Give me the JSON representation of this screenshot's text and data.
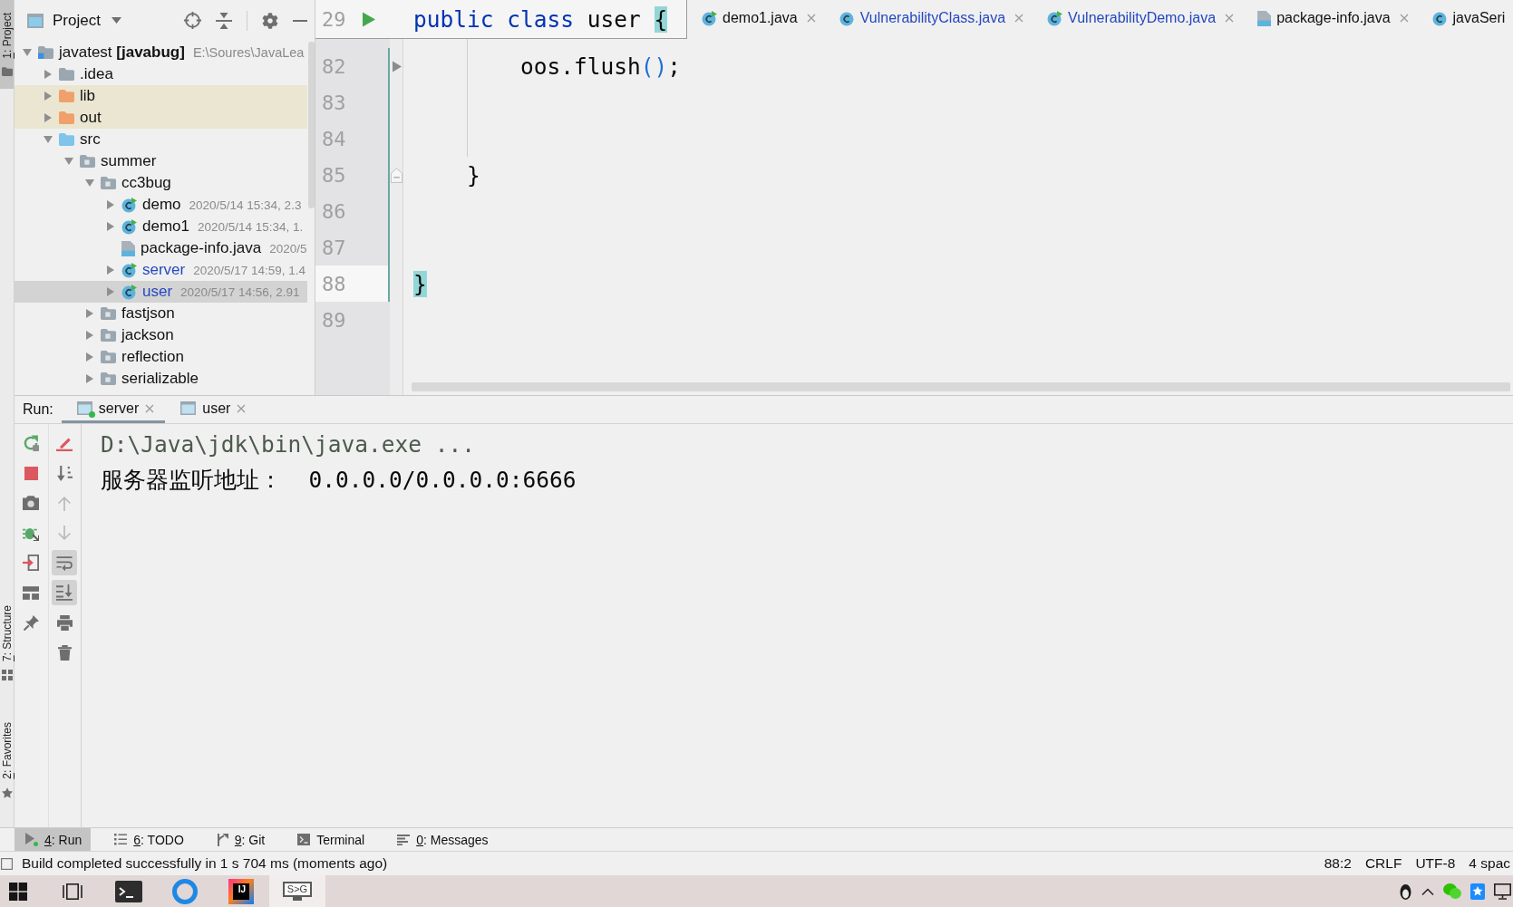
{
  "tool_stripe": [
    {
      "mnemonic": "1",
      "label": ": Project",
      "kind": "project",
      "selected": true
    },
    {
      "mnemonic": "7",
      "label": ": Structure",
      "kind": "structure",
      "selected": false
    },
    {
      "mnemonic": "2",
      "label": ": Favorites",
      "kind": "favorites",
      "selected": false
    }
  ],
  "project_panel": {
    "title": "Project",
    "tree": [
      {
        "name": "javatest **[javabug]**",
        "info": "E:\\Soures\\JavaLea",
        "kind": "module",
        "expanded": true,
        "selected": false,
        "modified": false,
        "children": [
          {
            "name": ".idea",
            "kind": "folder",
            "expanded": false,
            "selected": false,
            "modified": false
          },
          {
            "name": "lib",
            "kind": "excluded_folder",
            "expanded": false,
            "selected": false,
            "modified": false
          },
          {
            "name": "out",
            "kind": "excluded_folder",
            "expanded": false,
            "selected": false,
            "modified": false
          },
          {
            "name": "src",
            "kind": "source_folder",
            "expanded": true,
            "selected": false,
            "modified": false,
            "children": [
              {
                "name": "summer",
                "kind": "package",
                "expanded": true,
                "selected": false,
                "modified": false,
                "children": [
                  {
                    "name": "cc3bug",
                    "kind": "package",
                    "expanded": true,
                    "selected": false,
                    "modified": false,
                    "children": [
                      {
                        "name": "demo",
                        "info": "2020/5/14 15:34, 2.3",
                        "kind": "runnable_class",
                        "expanded": false,
                        "selected": false,
                        "modified": false
                      },
                      {
                        "name": "demo1",
                        "info": "2020/5/14 15:34, 1.",
                        "kind": "runnable_class",
                        "expanded": false,
                        "selected": false,
                        "modified": false
                      },
                      {
                        "name": "package-info.java",
                        "info": "2020/5",
                        "kind": "java_file",
                        "selected": false,
                        "modified": false
                      },
                      {
                        "name": "server",
                        "info": "2020/5/17 14:59, 1.4",
                        "kind": "runnable_class",
                        "expanded": false,
                        "selected": false,
                        "modified": true
                      },
                      {
                        "name": "user",
                        "info": "2020/5/17 14:56, 2.91",
                        "kind": "runnable_class",
                        "expanded": false,
                        "selected": true,
                        "modified": true
                      }
                    ]
                  },
                  {
                    "name": "fastjson",
                    "kind": "package",
                    "expanded": false,
                    "selected": false,
                    "modified": false
                  },
                  {
                    "name": "jackson",
                    "kind": "package",
                    "expanded": false,
                    "selected": false,
                    "modified": false
                  },
                  {
                    "name": "reflection",
                    "kind": "package",
                    "expanded": false,
                    "selected": false,
                    "modified": false
                  },
                  {
                    "name": "serializable",
                    "kind": "package",
                    "expanded": false,
                    "selected": false,
                    "modified": false
                  }
                ]
              }
            ]
          }
        ]
      }
    ]
  },
  "editor": {
    "sticky_line": {
      "number": "29",
      "tokens": [
        {
          "text": "public ",
          "kind": "keyword"
        },
        {
          "text": "class ",
          "kind": "keyword"
        },
        {
          "text": "user ",
          "kind": "plain"
        },
        {
          "text": "{",
          "kind": "brace_match"
        }
      ]
    },
    "tabs": [
      {
        "name": "demo1.java",
        "kind": "runnable_class",
        "modified": false,
        "selected": false,
        "closable": true
      },
      {
        "name": "VulnerabilityClass.java",
        "kind": "class",
        "modified": true,
        "selected": false,
        "closable": true
      },
      {
        "name": "VulnerabilityDemo.java",
        "kind": "runnable_class",
        "modified": true,
        "selected": false,
        "closable": true
      },
      {
        "name": "package-info.java",
        "kind": "java_file",
        "modified": false,
        "selected": false,
        "closable": true
      },
      {
        "name": "javaSeri",
        "kind": "class",
        "modified": false,
        "selected": false,
        "closable": false
      }
    ],
    "lines": [
      {
        "children": [
          {
            "children": [
              {
                "number": "82",
                "tokens": [
                  {
                    "text": "oos.flush",
                    "kind": "plain"
                  },
                  {
                    "text": "()",
                    "kind": "paren"
                  },
                  {
                    "text": ";",
                    "kind": "plain"
                  }
                ],
                "arrow_marker": true,
                "fold_end": false,
                "changed": true,
                "current": false
              },
              {
                "number": "83",
                "arrow_marker": false,
                "fold_end": false,
                "changed": true,
                "current": false
              },
              {
                "number": "84",
                "arrow_marker": false,
                "fold_end": false,
                "changed": true,
                "current": false
              }
            ]
          },
          {
            "number": "85",
            "tokens": [
              {
                "text": "}",
                "kind": "plain"
              }
            ],
            "arrow_marker": false,
            "fold_end": true,
            "changed": true,
            "current": false
          },
          {
            "number": "86",
            "arrow_marker": false,
            "fold_end": false,
            "changed": true,
            "current": false
          },
          {
            "number": "87",
            "arrow_marker": false,
            "fold_end": false,
            "changed": true,
            "current": false
          }
        ]
      },
      {
        "number": "88",
        "tokens": [
          {
            "text": "}",
            "kind": "brace_match"
          }
        ],
        "arrow_marker": false,
        "fold_end": false,
        "changed": true,
        "current": true
      },
      {
        "number": "89",
        "arrow_marker": false,
        "fold_end": false,
        "changed": false,
        "current": false
      }
    ]
  },
  "run_panel": {
    "label": "Run:",
    "tabs": [
      {
        "name": "server",
        "selected": true,
        "running": true
      },
      {
        "name": "user",
        "selected": false,
        "running": false
      }
    ],
    "toolbar_left": [
      {
        "kind": "rerun",
        "disabled": false,
        "pressed": false
      },
      {
        "kind": "stop",
        "disabled": false,
        "pressed": false
      },
      {
        "kind": "camera",
        "disabled": false,
        "pressed": false
      },
      {
        "kind": "bug",
        "disabled": false,
        "pressed": false
      },
      {
        "kind": "exit",
        "disabled": false,
        "pressed": false
      },
      {
        "kind": "layout",
        "disabled": false,
        "pressed": false
      },
      {
        "kind": "pin",
        "disabled": false,
        "pressed": false
      }
    ],
    "toolbar_right": [
      {
        "kind": "clear",
        "disabled": false,
        "pressed": false
      },
      {
        "kind": "sort",
        "disabled": false,
        "pressed": false
      },
      {
        "kind": "up",
        "disabled": true,
        "pressed": false
      },
      {
        "kind": "down",
        "disabled": true,
        "pressed": false
      },
      {
        "kind": "wrap",
        "disabled": false,
        "pressed": true
      },
      {
        "kind": "scroll_end",
        "disabled": false,
        "pressed": true
      },
      {
        "kind": "print",
        "disabled": false,
        "pressed": false
      },
      {
        "kind": "trash",
        "disabled": false,
        "pressed": false
      }
    ],
    "console": [
      {
        "text": "D:\\Java\\jdk\\bin\\java.exe ...",
        "kind": "command"
      },
      {
        "text": "服务器监听地址：  0.0.0.0/0.0.0.0:6666",
        "kind": "output"
      }
    ]
  },
  "tool_window_bar": [
    {
      "mnemonic": "4",
      "label": ": Run",
      "kind": "run",
      "selected": true
    },
    {
      "mnemonic": "6",
      "label": ": TODO",
      "kind": "todo",
      "selected": false
    },
    {
      "mnemonic": "9",
      "label": ": Git",
      "kind": "git",
      "selected": false
    },
    {
      "label": "Terminal",
      "kind": "terminal",
      "selected": false
    },
    {
      "mnemonic": "0",
      "label": ": Messages",
      "kind": "messages",
      "selected": false
    }
  ],
  "status_bar": {
    "message": "Build completed successfully in 1 s 704 ms (moments ago)",
    "widgets": [
      "88:2",
      "CRLF",
      "UTF-8",
      "4 spac"
    ]
  },
  "taskbar": {
    "apps": [
      {
        "kind": "start",
        "selected": false
      },
      {
        "kind": "task_view",
        "selected": false
      },
      {
        "kind": "terminal",
        "selected": false
      },
      {
        "kind": "ring",
        "selected": false
      },
      {
        "kind": "ide",
        "label": "IJ",
        "selected": false
      },
      {
        "kind": "monitor",
        "label": "S>G",
        "selected": true
      }
    ],
    "tray": [
      {
        "kind": "penguin"
      },
      {
        "kind": "caret"
      },
      {
        "kind": "chat"
      },
      {
        "kind": "star"
      },
      {
        "kind": "monitor"
      }
    ]
  }
}
